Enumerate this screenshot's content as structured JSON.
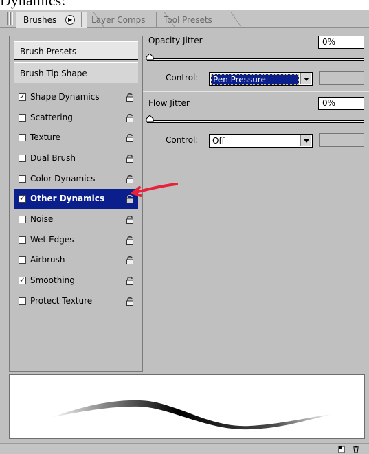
{
  "caption": {
    "text": "Dynamics:"
  },
  "tabs": [
    {
      "label": "Brushes",
      "active": true
    },
    {
      "label": "Layer Comps",
      "active": false
    },
    {
      "label": "Tool Presets",
      "active": false
    }
  ],
  "left_panel": {
    "presets_label": "Brush Presets",
    "tip_shape_label": "Brush Tip Shape",
    "options": [
      {
        "label": "Shape Dynamics",
        "checked": true
      },
      {
        "label": "Scattering",
        "checked": false
      },
      {
        "label": "Texture",
        "checked": false
      },
      {
        "label": "Dual Brush",
        "checked": false
      },
      {
        "label": "Color Dynamics",
        "checked": false
      },
      {
        "label": "Other Dynamics",
        "checked": true,
        "selected": true
      },
      {
        "label": "Noise",
        "checked": false
      },
      {
        "label": "Wet Edges",
        "checked": false
      },
      {
        "label": "Airbrush",
        "checked": false
      },
      {
        "label": "Smoothing",
        "checked": true
      },
      {
        "label": "Protect Texture",
        "checked": false
      }
    ]
  },
  "right_panel": {
    "opacity_jitter": {
      "label": "Opacity Jitter",
      "value": "0%",
      "control_label": "Control:",
      "control_value": "Pen Pressure"
    },
    "flow_jitter": {
      "label": "Flow Jitter",
      "value": "0%",
      "control_label": "Control:",
      "control_value": "Off"
    }
  },
  "icons": {
    "lock": "lock-icon",
    "tab_menu": "play-circle-icon",
    "arrow": "red-arrow-annotation",
    "new_preset": "new-preset-icon",
    "trash": "trash-icon"
  },
  "colors": {
    "selection": "#0a1e8c",
    "annotation": "#e8213a"
  }
}
